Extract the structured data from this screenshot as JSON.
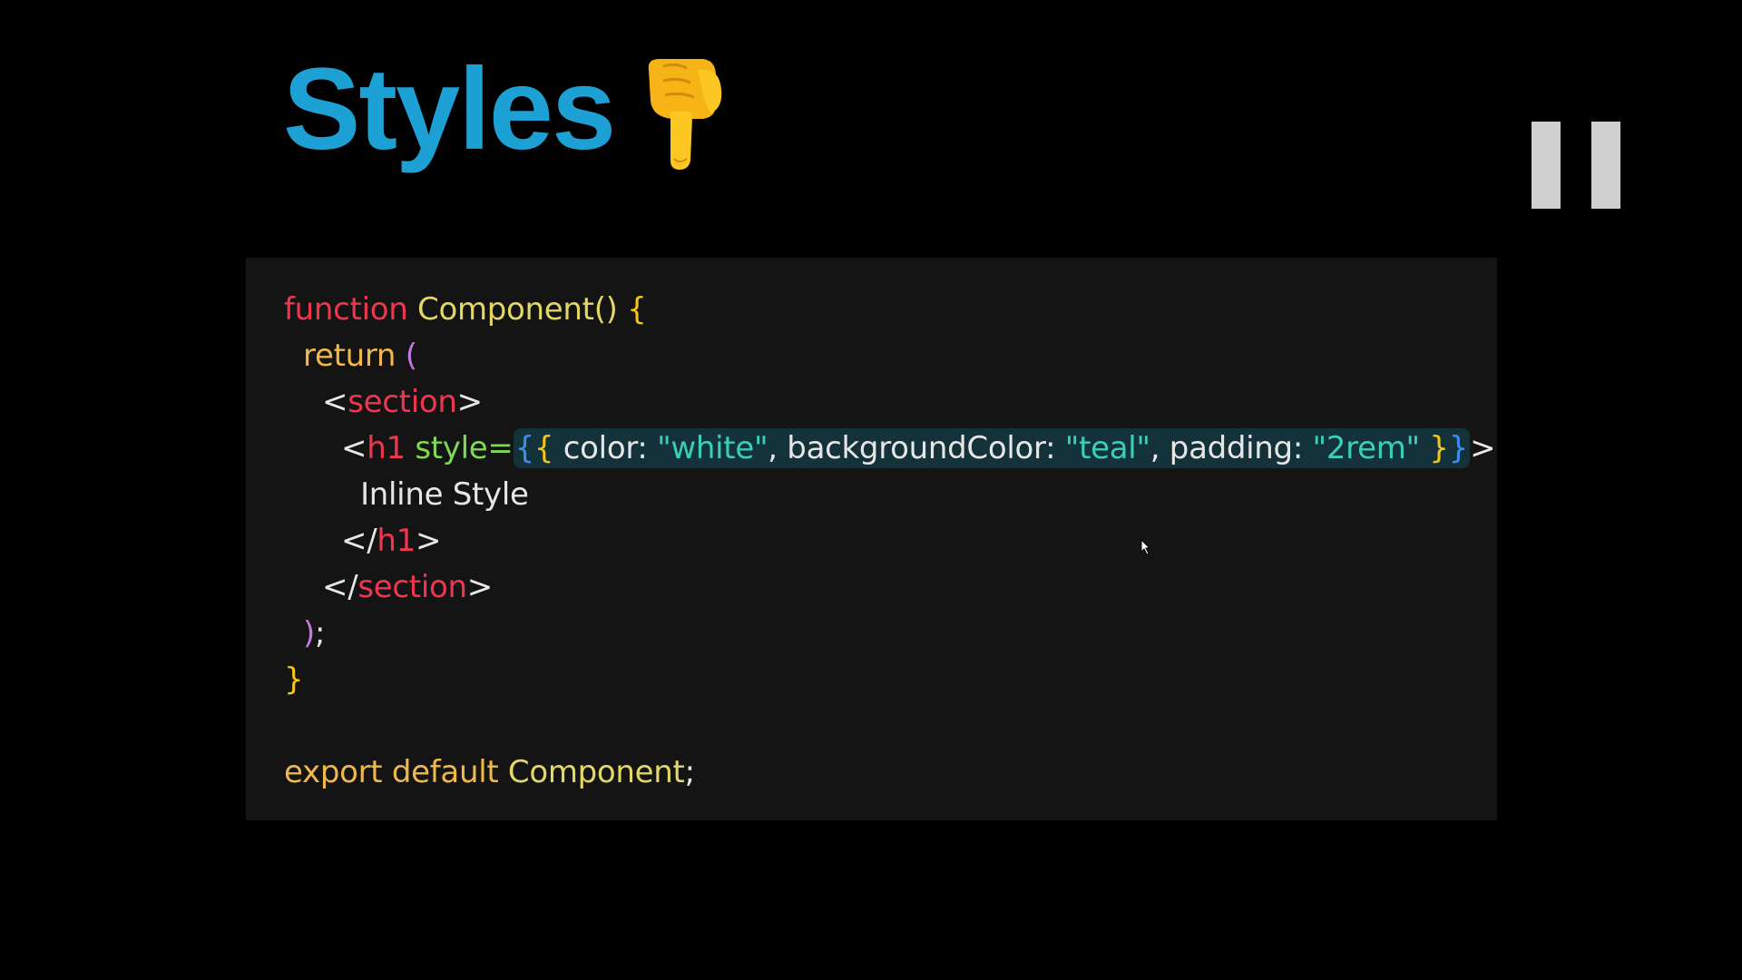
{
  "slide": {
    "title": "Styles",
    "title_icon": "pointing-down-hand-icon",
    "pause_icon": "pause-icon"
  },
  "colors": {
    "background": "#000000",
    "title": "#1da1d4",
    "code_background": "#141414",
    "keyword": "#f0364e",
    "function_name": "#e3d864",
    "brace": "#f5c518",
    "paren": "#c678dd",
    "plain": "#e6e6e6",
    "attribute": "#7ed957",
    "string": "#3ccfb8",
    "export": "#f0b84a",
    "expression_brace": "#3b8ef0",
    "highlight_background": "#14323a",
    "pause_bars": "#d0d0d0"
  },
  "code": {
    "line1": {
      "kw": "function",
      "sp": " ",
      "name": "Component()",
      "sp2": " ",
      "brace": "{"
    },
    "line2": {
      "indent": "  ",
      "kw": "return",
      "sp": " ",
      "paren": "("
    },
    "line3": {
      "indent": "    ",
      "lt": "<",
      "tag": "section",
      "gt": ">"
    },
    "line4": {
      "indent": "      ",
      "lt": "<",
      "tag": "h1",
      "sp": " ",
      "attr": "style=",
      "open_expr": "{",
      "open_obj": "{",
      "p1": " color: ",
      "s1": "\"white\"",
      "p2": ", backgroundColor: ",
      "s2": "\"teal\"",
      "p3": ", padding: ",
      "s3": "\"2rem\"",
      "p4": " ",
      "close_obj": "}",
      "close_expr": "}",
      "gt": ">"
    },
    "line5": {
      "indent": "        ",
      "text": "Inline Style"
    },
    "line6": {
      "indent": "      ",
      "lt": "</",
      "tag": "h1",
      "gt": ">"
    },
    "line7": {
      "indent": "    ",
      "lt": "</",
      "tag": "section",
      "gt": ">"
    },
    "line8": {
      "indent": "  ",
      "paren": ")",
      "semi": ";"
    },
    "line9": {
      "brace": "}"
    },
    "line11": {
      "kw": "export default",
      "sp": " ",
      "name": "Component",
      "semi": ";"
    }
  }
}
